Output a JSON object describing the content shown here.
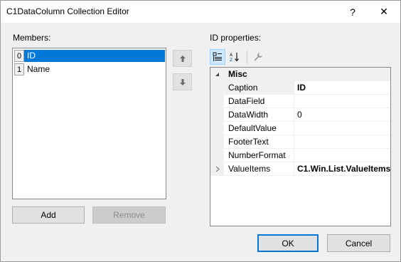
{
  "window": {
    "title": "C1DataColumn Collection Editor",
    "help_glyph": "?",
    "close_glyph": "✕"
  },
  "members": {
    "label": "Members:",
    "items": [
      {
        "index": "0",
        "name": "ID",
        "selected": true
      },
      {
        "index": "1",
        "name": "Name",
        "selected": false
      }
    ],
    "add_label": "Add",
    "remove_label": "Remove",
    "move_up_icon": "arrow-up",
    "move_down_icon": "arrow-down"
  },
  "properties": {
    "label": "ID properties:",
    "toolbar": {
      "categorized_icon": "categorized",
      "alphabetical_icon": "sort-az",
      "property_pages_icon": "wrench"
    },
    "category": "Misc",
    "rows": [
      {
        "name": "Caption",
        "value": "ID",
        "bold": true
      },
      {
        "name": "DataField",
        "value": ""
      },
      {
        "name": "DataWidth",
        "value": "0"
      },
      {
        "name": "DefaultValue",
        "value": ""
      },
      {
        "name": "FooterText",
        "value": ""
      },
      {
        "name": "NumberFormat",
        "value": ""
      },
      {
        "name": "ValueItems",
        "value": "C1.Win.List.ValueItems",
        "bold": true,
        "expandable": true
      }
    ]
  },
  "footer": {
    "ok_label": "OK",
    "cancel_label": "Cancel"
  },
  "colors": {
    "selection": "#0078d7",
    "window_bg": "#f0f0f0"
  }
}
